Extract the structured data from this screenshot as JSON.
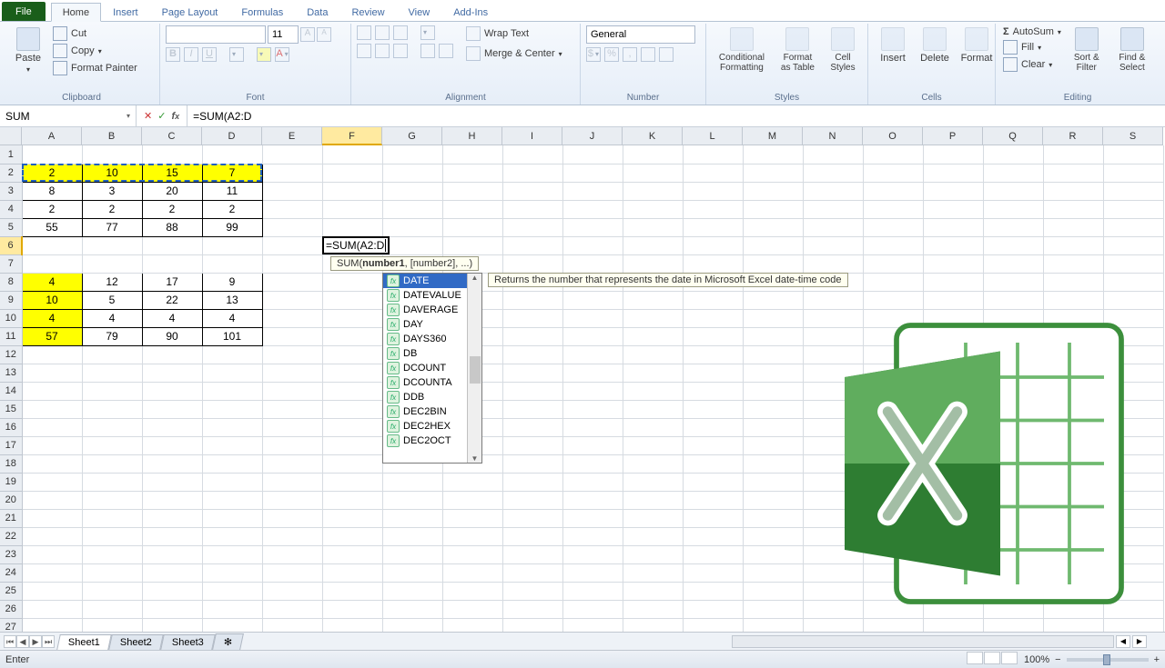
{
  "tabs": {
    "file": "File",
    "items": [
      "Home",
      "Insert",
      "Page Layout",
      "Formulas",
      "Data",
      "Review",
      "View",
      "Add-Ins"
    ],
    "active": 0
  },
  "ribbon": {
    "clipboard": {
      "label": "Clipboard",
      "paste": "Paste",
      "cut": "Cut",
      "copy": "Copy",
      "painter": "Format Painter"
    },
    "font": {
      "label": "Font",
      "name": "",
      "size": "11"
    },
    "alignment": {
      "label": "Alignment",
      "wrap": "Wrap Text",
      "merge": "Merge & Center"
    },
    "number": {
      "label": "Number",
      "format": "General"
    },
    "styles": {
      "label": "Styles",
      "cond": "Conditional Formatting",
      "table": "Format as Table",
      "cell": "Cell Styles"
    },
    "cells": {
      "label": "Cells",
      "insert": "Insert",
      "delete": "Delete",
      "format": "Format"
    },
    "editing": {
      "label": "Editing",
      "autosum": "AutoSum",
      "fill": "Fill",
      "clear": "Clear",
      "sort": "Sort & Filter",
      "find": "Find & Select"
    }
  },
  "namebox": "SUM",
  "formula": "=SUM(A2:D",
  "columns": [
    "A",
    "B",
    "C",
    "D",
    "E",
    "F",
    "G",
    "H",
    "I",
    "J",
    "K",
    "L",
    "M",
    "N",
    "O",
    "P",
    "Q",
    "R",
    "S"
  ],
  "active_col": "F",
  "active_row": 6,
  "rows": 27,
  "data": {
    "r2": {
      "A": "2",
      "B": "10",
      "C": "15",
      "D": "7"
    },
    "r3": {
      "A": "8",
      "B": "3",
      "C": "20",
      "D": "11"
    },
    "r4": {
      "A": "2",
      "B": "2",
      "C": "2",
      "D": "2"
    },
    "r5": {
      "A": "55",
      "B": "77",
      "C": "88",
      "D": "99"
    },
    "r8": {
      "A": "4",
      "B": "12",
      "C": "17",
      "D": "9"
    },
    "r9": {
      "A": "10",
      "B": "5",
      "C": "22",
      "D": "13"
    },
    "r10": {
      "A": "4",
      "B": "4",
      "C": "4",
      "D": "4"
    },
    "r11": {
      "A": "57",
      "B": "79",
      "C": "90",
      "D": "101"
    }
  },
  "bordered_rows": [
    2,
    3,
    4,
    5,
    8,
    9,
    10,
    11
  ],
  "yellow_cells": [
    "A2",
    "B2",
    "C2",
    "D2",
    "A8",
    "A9",
    "A10",
    "A11"
  ],
  "editor": {
    "text": "=SUM(A2:D"
  },
  "fn_tooltip": {
    "prefix": "SUM(",
    "b": "number1",
    "rest": ", [number2], ...)"
  },
  "ac": {
    "items": [
      "DATE",
      "DATEVALUE",
      "DAVERAGE",
      "DAY",
      "DAYS360",
      "DB",
      "DCOUNT",
      "DCOUNTA",
      "DDB",
      "DEC2BIN",
      "DEC2HEX",
      "DEC2OCT"
    ],
    "selected": 0,
    "desc": "Returns the number that represents the date in Microsoft Excel date-time code"
  },
  "sheets": {
    "items": [
      "Sheet1",
      "Sheet2",
      "Sheet3"
    ],
    "active": 0
  },
  "status": {
    "mode": "Enter",
    "zoom": "100%"
  }
}
